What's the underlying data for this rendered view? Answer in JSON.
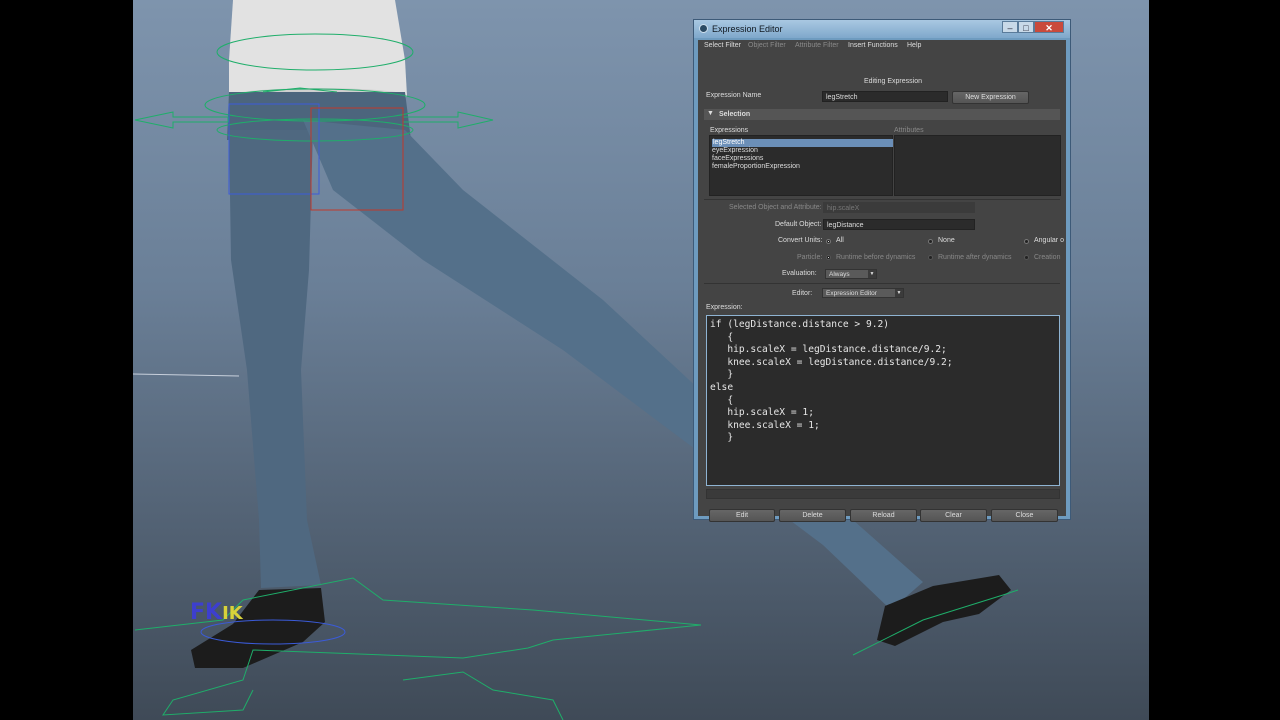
{
  "window": {
    "title": "Expression Editor",
    "min_glyph": "–",
    "max_glyph": "□",
    "close_glyph": "✕"
  },
  "menu": [
    "Select Filter",
    "Object Filter",
    "Attribute Filter",
    "Insert Functions",
    "Help"
  ],
  "editing_label": "Editing Expression",
  "expression_name": {
    "label": "Expression Name",
    "value": "legStretch"
  },
  "new_expression_button": "New Expression",
  "selection_section": {
    "title": "Selection",
    "arrow": "▼"
  },
  "expressions_header": "Expressions",
  "attributes_header": "Attributes",
  "expressions_list": [
    "legStretch",
    "eyeExpression",
    "faceExpressions",
    "femaleProportionExpression"
  ],
  "selected_object": {
    "label": "Selected Object and Attribute:",
    "value": "hip.scaleX"
  },
  "default_object": {
    "label": "Default Object:",
    "value": "legDistance"
  },
  "convert_units": {
    "label": "Convert Units:",
    "options": [
      "All",
      "None",
      "Angular o"
    ],
    "selected": "All"
  },
  "particle": {
    "label": "Particle:",
    "options": [
      "Runtime before dynamics",
      "Runtime after dynamics",
      "Creation"
    ]
  },
  "evaluation": {
    "label": "Evaluation:",
    "value": "Always"
  },
  "editor_type": {
    "label": "Editor:",
    "value": "Expression Editor"
  },
  "expression_label": "Expression:",
  "expression_code": "if (legDistance.distance > 9.2)\n   {\n   hip.scaleX = legDistance.distance/9.2;\n   knee.scaleX = legDistance.distance/9.2;\n   }\nelse\n   {\n   hip.scaleX = 1;\n   knee.scaleX = 1;\n   }",
  "buttons": {
    "edit": "Edit",
    "delete": "Delete",
    "reload": "Reload",
    "clear": "Clear",
    "close": "Close"
  },
  "viewport": {
    "fk_label": "FK",
    "ik_label": "IK"
  },
  "colors": {
    "viewport_top": "#7e94ad",
    "viewport_bottom": "#3f4a57",
    "selection": "#6b8fb8",
    "pants": "#4f6880",
    "shoes": "#1c1c1c",
    "controls": "#1fae6a"
  }
}
